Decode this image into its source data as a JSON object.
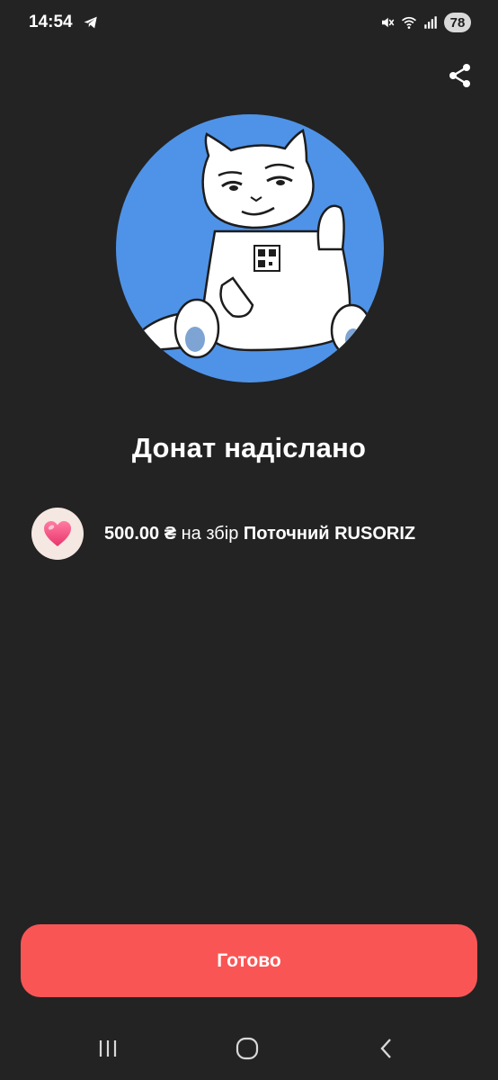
{
  "status_bar": {
    "time": "14:54",
    "battery": "78",
    "icons": [
      "telegram-icon",
      "mute-vibrate-icon",
      "wifi-icon",
      "signal-icon",
      "battery-icon"
    ]
  },
  "header": {
    "share_icon": "share-icon"
  },
  "hero": {
    "illustration": "cat-illustration",
    "circle_color": "#4f93e8"
  },
  "main": {
    "title": "Донат надіслано",
    "donation": {
      "amount": "500.00 ₴",
      "connector": "на збір",
      "campaign": "Поточний RUSORIZ",
      "icon": "heart-icon"
    }
  },
  "actions": {
    "done_label": "Готово",
    "done_color": "#fa5555"
  },
  "nav": {
    "recents_icon": "recents-icon",
    "home_icon": "home-icon",
    "back_icon": "back-icon"
  }
}
